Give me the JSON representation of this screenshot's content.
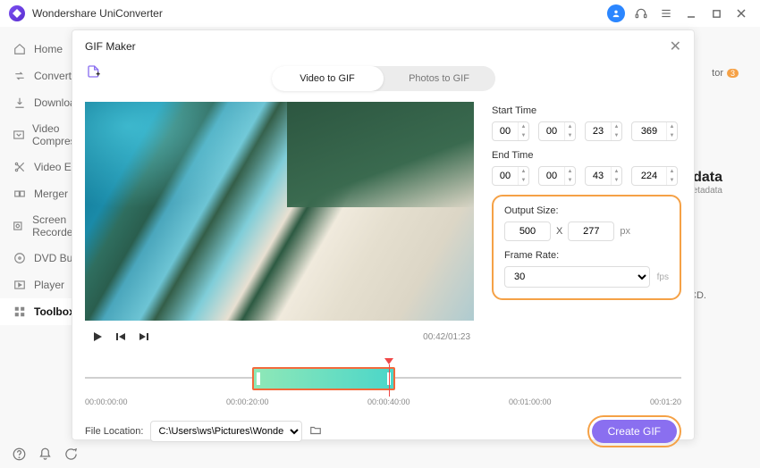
{
  "app": {
    "title": "Wondershare UniConverter"
  },
  "sidebar": {
    "items": [
      {
        "label": "Home"
      },
      {
        "label": "Converter"
      },
      {
        "label": "Downloader"
      },
      {
        "label": "Video Compressor"
      },
      {
        "label": "Video Editor"
      },
      {
        "label": "Merger"
      },
      {
        "label": "Screen Recorder"
      },
      {
        "label": "DVD Burner"
      },
      {
        "label": "Player"
      },
      {
        "label": "Toolbox"
      }
    ]
  },
  "gif": {
    "title": "GIF Maker",
    "tabs": {
      "video": "Video to GIF",
      "photos": "Photos to GIF"
    },
    "startLabel": "Start Time",
    "endLabel": "End Time",
    "start": {
      "h": "00",
      "m": "00",
      "s": "23",
      "ms": "369"
    },
    "end": {
      "h": "00",
      "m": "00",
      "s": "43",
      "ms": "224"
    },
    "outputSizeLabel": "Output Size:",
    "outW": "500",
    "sizeX": "X",
    "outH": "277",
    "px": "px",
    "frameRateLabel": "Frame Rate:",
    "fps": "30",
    "fpsUnit": "fps",
    "playTime": "00:42/01:23",
    "ticks": [
      "00:00:00:00",
      "00:00:20:00",
      "00:00:40:00",
      "00:01:00:00",
      "00:01:20"
    ],
    "fileLocLabel": "File Location:",
    "fileLoc": "C:\\Users\\ws\\Pictures\\Wonders",
    "createLabel": "Create GIF"
  },
  "bg": {
    "tor": "tor",
    "badge": "3",
    "metaTitle": "data",
    "metaSub": "etadata",
    "cd": "CD."
  }
}
